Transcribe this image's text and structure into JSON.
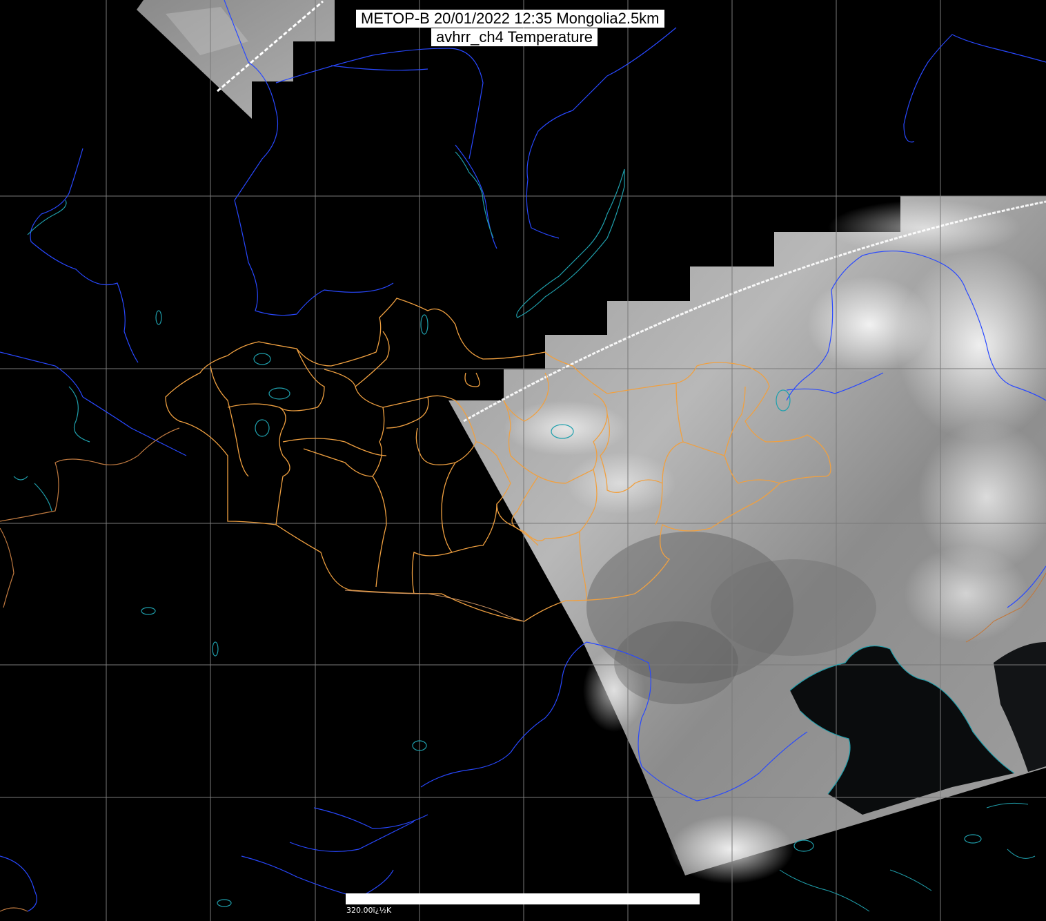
{
  "title": {
    "line1": "METOP-B 20/01/2022 12:35 Mongolia2.5km",
    "line2": "avhrr_ch4 Temperature"
  },
  "scale": {
    "label": "320.00ï¿½K"
  },
  "colors": {
    "background": "#000000",
    "grid": "#7a7a7a",
    "rivers": "#2040ff",
    "lakes": "#1f9aa6",
    "borders_internal": "#f0a040",
    "borders_international": "#c07030",
    "swath_dark": "#3c3c3c",
    "swath_mid": "#8a8a8a",
    "swath_light": "#d8d8d8",
    "sea": "#111416"
  },
  "layers": [
    "grid",
    "satellite-swath",
    "rivers",
    "lakes",
    "province-borders",
    "country-borders"
  ]
}
